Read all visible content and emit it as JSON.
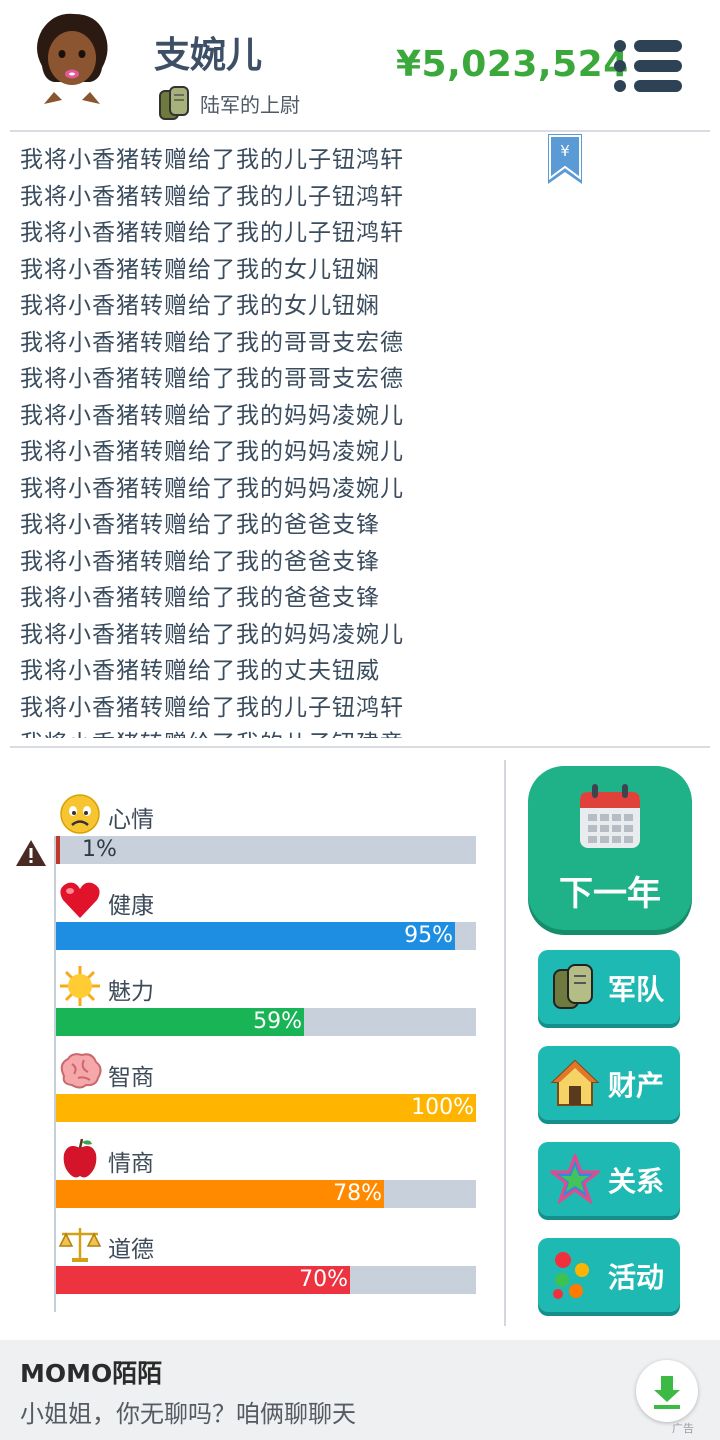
{
  "header": {
    "name": "支婉儿",
    "rank": "陆军的上尉",
    "money": "¥5,023,524",
    "menu_icon": "hamburger-menu-icon"
  },
  "log": {
    "bookmark_symbol": "¥",
    "lines": [
      "我将小香猪转赠给了我的儿子钮鸿轩",
      "我将小香猪转赠给了我的儿子钮鸿轩",
      "我将小香猪转赠给了我的儿子钮鸿轩",
      "我将小香猪转赠给了我的女儿钮娴",
      "我将小香猪转赠给了我的女儿钮娴",
      "我将小香猪转赠给了我的哥哥支宏德",
      "我将小香猪转赠给了我的哥哥支宏德",
      "我将小香猪转赠给了我的妈妈凌婉儿",
      "我将小香猪转赠给了我的妈妈凌婉儿",
      "我将小香猪转赠给了我的妈妈凌婉儿",
      "我将小香猪转赠给了我的爸爸支锋",
      "我将小香猪转赠给了我的爸爸支锋",
      "我将小香猪转赠给了我的爸爸支锋",
      "我将小香猪转赠给了我的妈妈凌婉儿",
      "我将小香猪转赠给了我的丈夫钮威",
      "我将小香猪转赠给了我的儿子钮鸿轩",
      "我将小香猪转赠给了我的儿子钮建章"
    ]
  },
  "stats": [
    {
      "label": "心情",
      "value": 1,
      "text": "1%",
      "color": "#c0392b",
      "icon": "sad-face-icon"
    },
    {
      "label": "健康",
      "value": 95,
      "text": "95%",
      "color": "#1e8ee2",
      "icon": "heart-icon"
    },
    {
      "label": "魅力",
      "value": 59,
      "text": "59%",
      "color": "#19b455",
      "icon": "sun-icon"
    },
    {
      "label": "智商",
      "value": 100,
      "text": "100%",
      "color": "#ffb400",
      "icon": "brain-icon"
    },
    {
      "label": "情商",
      "value": 78,
      "text": "78%",
      "color": "#ff8a00",
      "icon": "apple-icon"
    },
    {
      "label": "道德",
      "value": 70,
      "text": "70%",
      "color": "#ee3340",
      "icon": "scales-icon"
    }
  ],
  "actions": {
    "next_year": "下一年",
    "army": "军队",
    "property": "财产",
    "relations": "关系",
    "activities": "活动"
  },
  "ad": {
    "title": "MOMO陌陌",
    "subtitle": "小姐姐，你无聊吗？咱俩聊聊天",
    "tag": "广告"
  },
  "colors": {
    "money": "#3aa83a",
    "next_year_bg": "#1fb187",
    "side_button_bg": "#1fb9b3"
  }
}
